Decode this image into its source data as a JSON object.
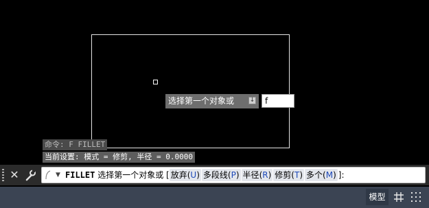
{
  "canvas": {
    "dynamic_prompt": "选择第一个对象或",
    "dynamic_input_value": "f",
    "history": [
      "命令: F FILLET",
      "当前设置: 模式 = 修剪, 半径 = 0.0000"
    ]
  },
  "command_line": {
    "command": "FILLET",
    "prompt": "选择第一个对象或",
    "open_bracket": "[",
    "options": [
      {
        "label": "放弃",
        "key": "U"
      },
      {
        "label": "多段线",
        "key": "P"
      },
      {
        "label": "半径",
        "key": "R"
      },
      {
        "label": "修剪",
        "key": "T"
      },
      {
        "label": "多个",
        "key": "M"
      }
    ],
    "close": "]:"
  },
  "status_bar": {
    "model_tab": "模型"
  },
  "colors": {
    "canvas_bg": "#000000",
    "option_key": "#1d49b8",
    "status_bar_bg": "#3b4453"
  }
}
